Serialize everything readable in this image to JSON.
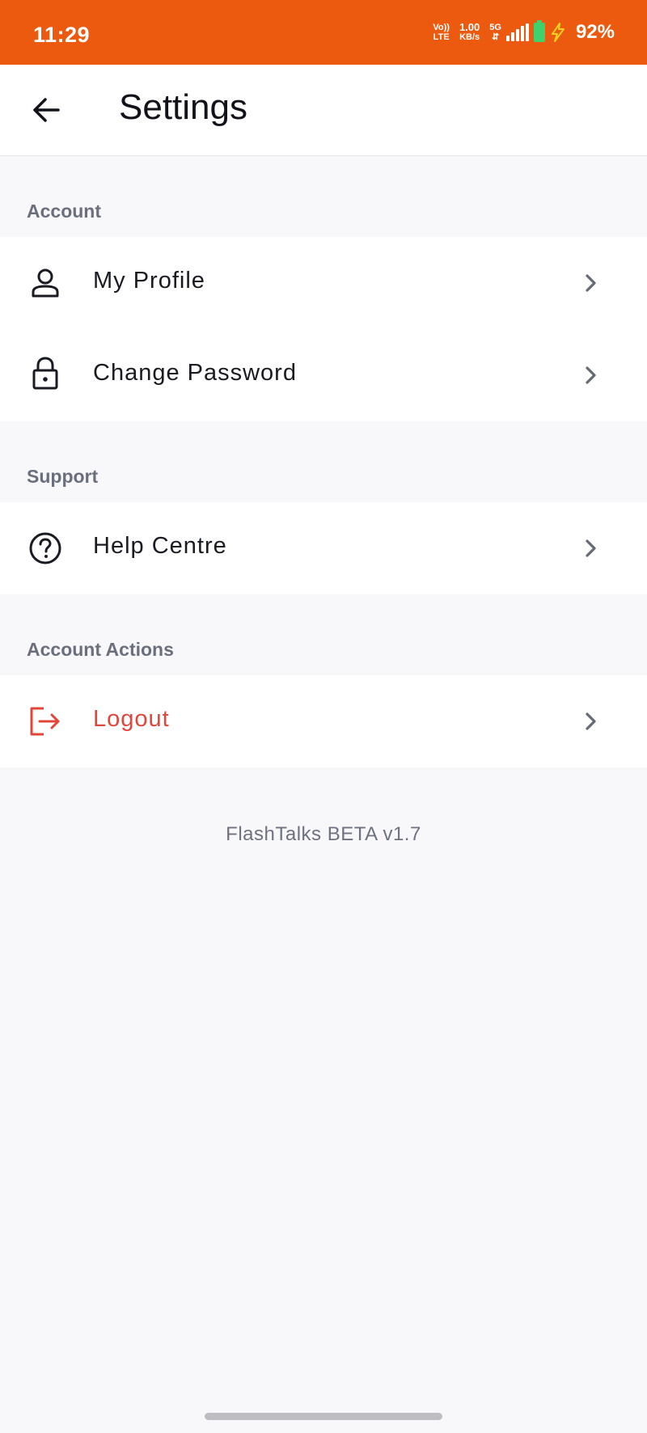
{
  "status_bar": {
    "time": "11:29",
    "volte_top": "Vo))",
    "volte_bottom": "LTE",
    "speed_value": "1.00",
    "speed_unit": "KB/s",
    "network": "5G",
    "battery": "92%"
  },
  "header": {
    "title": "Settings",
    "back_icon": "arrow-left-icon"
  },
  "sections": [
    {
      "title": "Account",
      "items": [
        {
          "label": "My Profile",
          "icon": "person-icon"
        },
        {
          "label": "Change Password",
          "icon": "lock-icon"
        }
      ]
    },
    {
      "title": "Support",
      "items": [
        {
          "label": "Help Centre",
          "icon": "help-circle-icon"
        }
      ]
    },
    {
      "title": "Account Actions",
      "items": [
        {
          "label": "Logout",
          "icon": "logout-icon",
          "color": "#e0473a"
        }
      ]
    }
  ],
  "footer": {
    "version": "FlashTalks BETA v1.7"
  },
  "colors": {
    "accent": "#ec5a0f",
    "danger": "#e0473a"
  }
}
